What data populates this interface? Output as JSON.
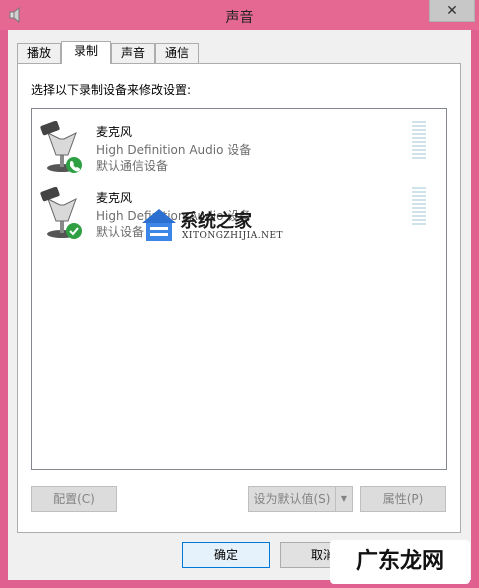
{
  "window": {
    "title": "声音",
    "close_label": "✕"
  },
  "tabs": [
    {
      "label": "播放",
      "active": false
    },
    {
      "label": "录制",
      "active": true
    },
    {
      "label": "声音",
      "active": false
    },
    {
      "label": "通信",
      "active": false
    }
  ],
  "panel": {
    "instruction": "选择以下录制设备来修改设置:"
  },
  "devices": [
    {
      "name": "麦克风",
      "description": "High Definition Audio 设备",
      "status": "默认通信设备",
      "badge": "phone"
    },
    {
      "name": "麦克风",
      "description": "High Definition Audio 设备",
      "status": "默认设备",
      "badge": "check"
    }
  ],
  "watermark": {
    "title": "系统之家",
    "subtitle": "XITONGZHIJIA.NET"
  },
  "buttons": {
    "configure": "配置(C)",
    "set_default": "设为默认值(S)",
    "properties": "属性(P)",
    "ok": "确定",
    "cancel": "取消"
  },
  "overlay": {
    "brand": "广东龙网"
  },
  "colors": {
    "frame": "#e0608f",
    "badge_green": "#2ea043"
  }
}
